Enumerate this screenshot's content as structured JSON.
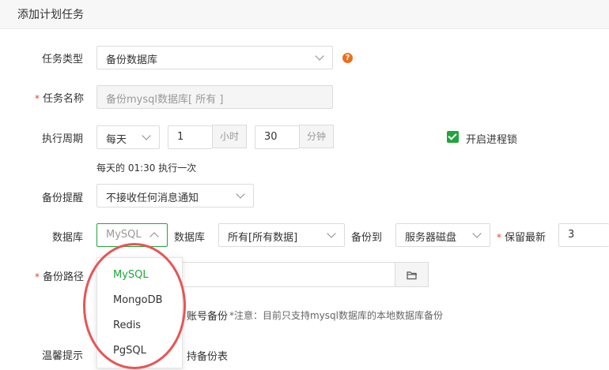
{
  "dialog": {
    "title": "添加计划任务"
  },
  "task_type": {
    "label": "任务类型",
    "value": "备份数据库",
    "help_icon": "?"
  },
  "task_name": {
    "required": "*",
    "label": "任务名称",
    "value": "备份mysql数据库[ 所有 ]"
  },
  "period": {
    "label": "执行周期",
    "frequency": "每天",
    "hour_value": "1",
    "hour_unit": "小时",
    "minute_value": "30",
    "minute_unit": "分钟",
    "summary": "每天的 01:30 执行一次",
    "process_lock_label": "开启进程锁",
    "process_lock_checked": true
  },
  "backup_notify": {
    "label": "备份提醒",
    "value": "不接收任何消息通知"
  },
  "database_row": {
    "label": "数据库",
    "type_value": "MySQL",
    "db_label": "数据库",
    "db_value": "所有[所有数据]",
    "backup_to_label": "备份到",
    "backup_to_value": "服务器磁盘",
    "retain_required": "*",
    "retain_label": "保留最新",
    "retain_value": "3"
  },
  "backup_path": {
    "required": "*",
    "label": "备份路径"
  },
  "account_note": {
    "prefix": "账号备份",
    "notice": "*注意：目前只支持mysql数据库的本地数据库备份"
  },
  "tips": {
    "label": "温馨提示",
    "text": "持备份表"
  },
  "db_type_dropdown": {
    "options": [
      "MySQL",
      "MongoDB",
      "Redis",
      "PgSQL"
    ],
    "selected": "MySQL"
  },
  "colors": {
    "accent": "#20a53a",
    "required": "#e8442b",
    "help": "#f06e18",
    "annotation": "#e95454"
  }
}
